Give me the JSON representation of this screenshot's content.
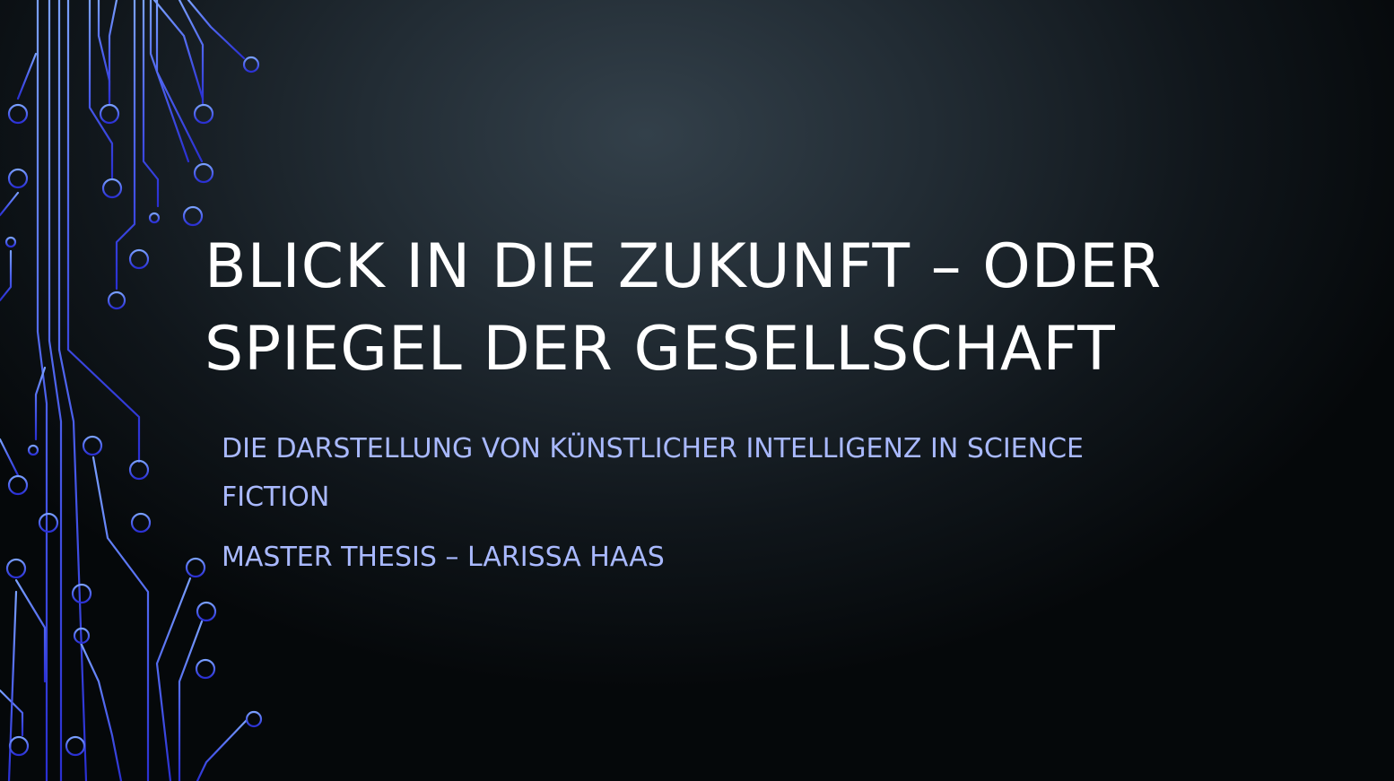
{
  "slide": {
    "title": "BLICK IN DIE ZUKUNFT – ODER SPIEGEL DER GESELLSCHAFT",
    "subtitle": "DIE DARSTELLUNG VON KÜNSTLICHER INTELLIGENZ IN SCIENCE FICTION",
    "author_line": "MASTER THESIS – LARISSA HAAS"
  },
  "decoration": {
    "name": "circuit-board-graphic",
    "colors": {
      "top": "#6f95ff",
      "bottom": "#2f35d6"
    }
  },
  "colors": {
    "title": "#ffffff",
    "subtitle": "#a9b9ff",
    "background_center": "#33404a",
    "background_edge": "#05080a"
  }
}
